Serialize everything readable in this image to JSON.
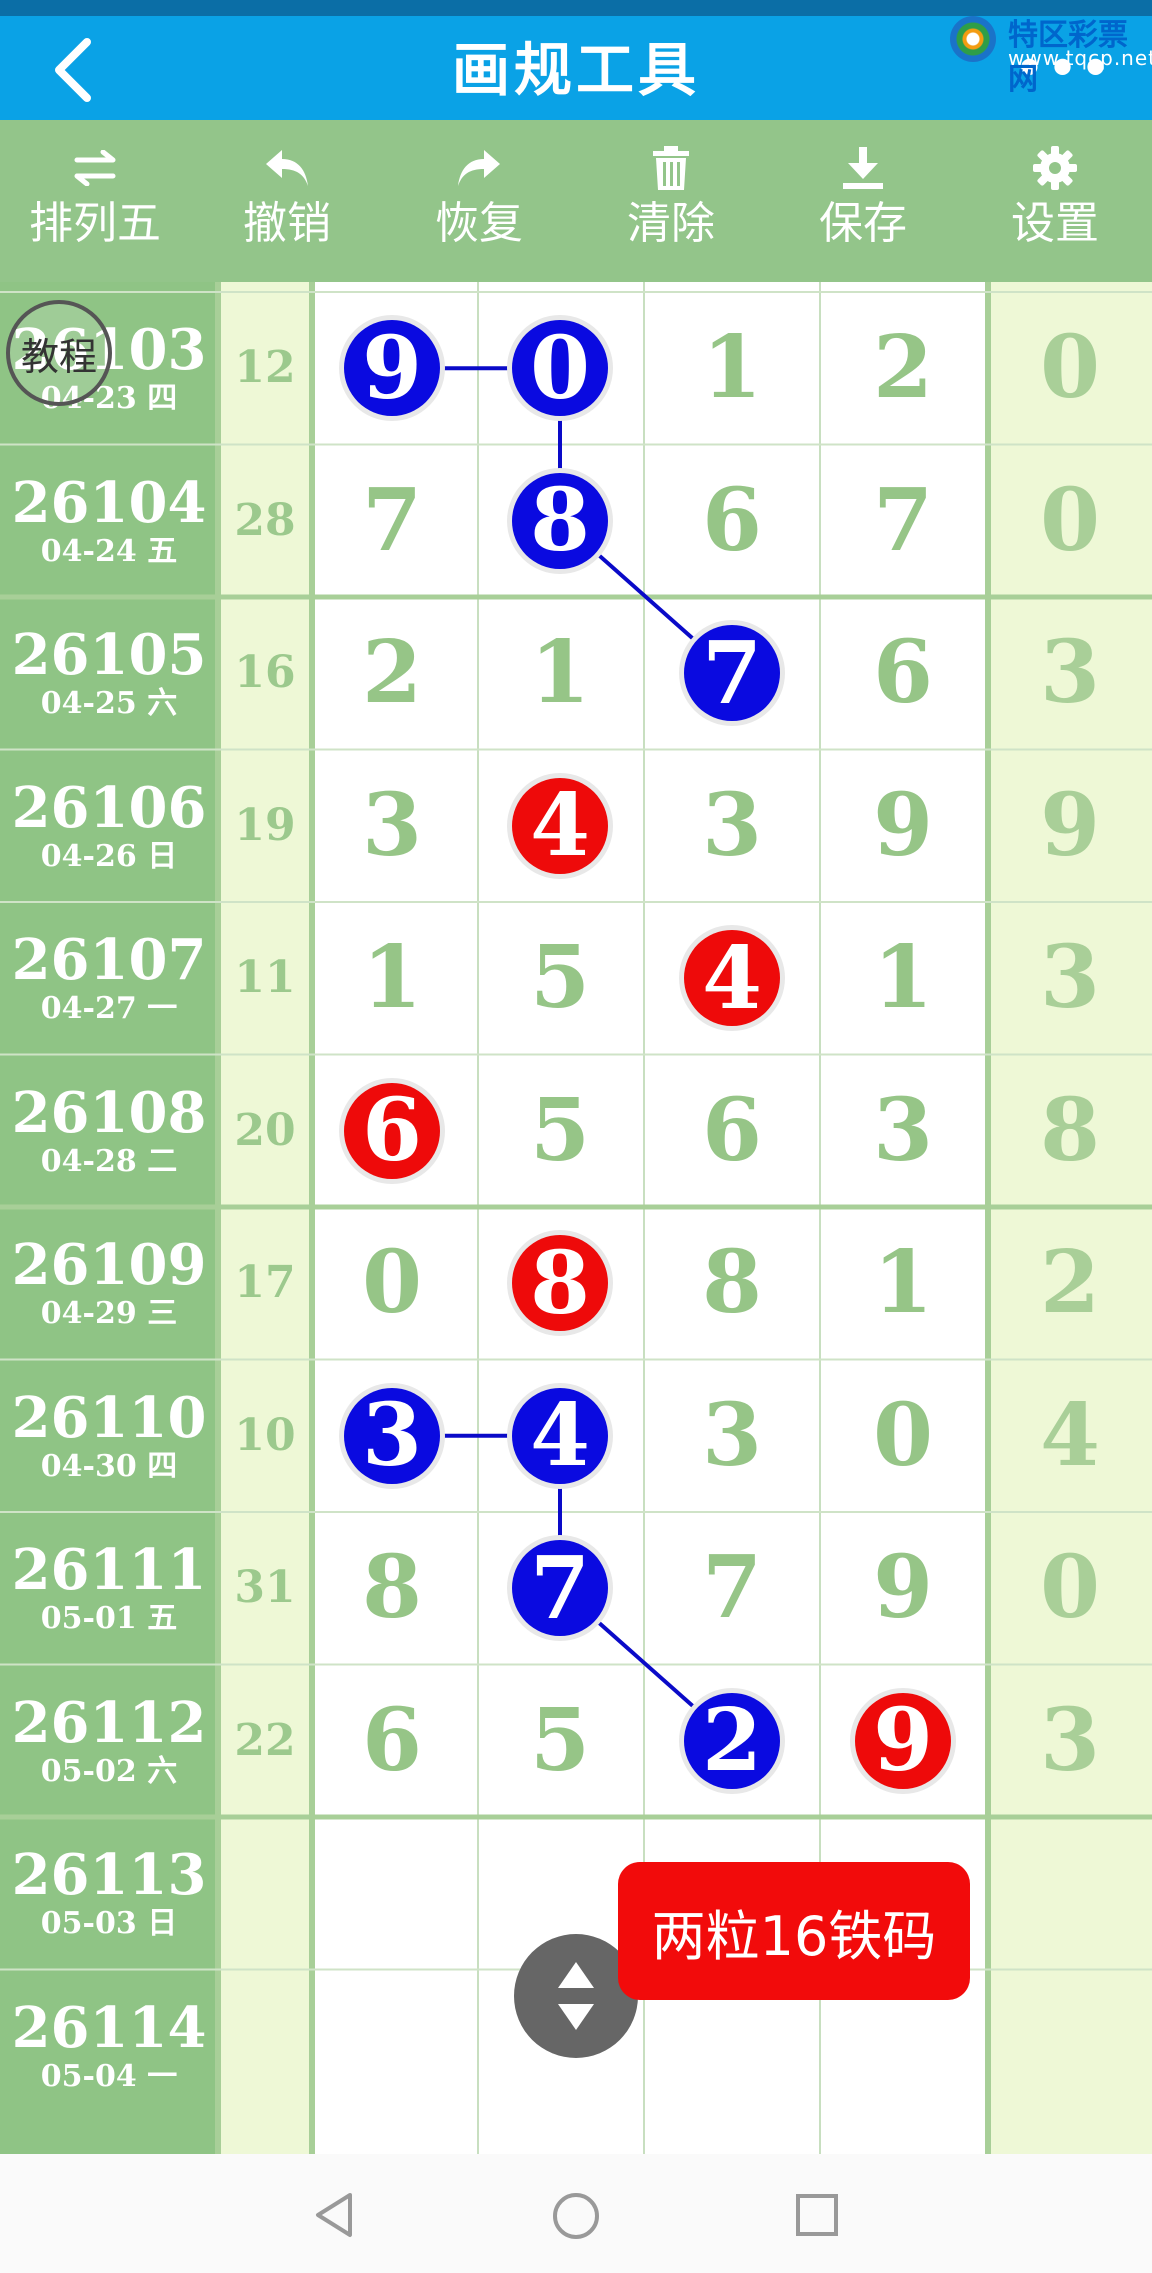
{
  "header": {
    "title": "画规工具",
    "more": "•••"
  },
  "logo": {
    "name": "特区彩票网",
    "url_text": "www.tqcp.net"
  },
  "toolbar": [
    {
      "label": "排列五",
      "icon": "swap-arrows-icon"
    },
    {
      "label": "撤销",
      "icon": "undo-icon"
    },
    {
      "label": "恢复",
      "icon": "redo-icon"
    },
    {
      "label": "清除",
      "icon": "trash-icon"
    },
    {
      "label": "保存",
      "icon": "download-icon"
    },
    {
      "label": "设置",
      "icon": "gear-icon"
    }
  ],
  "tutorial_badge": "教程",
  "rows": [
    {
      "period": "26103",
      "date": "04-23 四",
      "sum": "12",
      "digits": [
        "9",
        "0",
        "1",
        "2"
      ],
      "right": "0",
      "balls": [
        {
          "col": 0,
          "color": "blue"
        },
        {
          "col": 1,
          "color": "blue"
        }
      ]
    },
    {
      "period": "26104",
      "date": "04-24 五",
      "sum": "28",
      "digits": [
        "7",
        "8",
        "6",
        "7"
      ],
      "right": "0",
      "balls": [
        {
          "col": 1,
          "color": "blue"
        }
      ]
    },
    {
      "period": "26105",
      "date": "04-25 六",
      "sum": "16",
      "digits": [
        "2",
        "1",
        "7",
        "6"
      ],
      "right": "3",
      "balls": [
        {
          "col": 2,
          "color": "blue"
        }
      ]
    },
    {
      "period": "26106",
      "date": "04-26 日",
      "sum": "19",
      "digits": [
        "3",
        "4",
        "3",
        "9"
      ],
      "right": "9",
      "balls": [
        {
          "col": 1,
          "color": "red"
        }
      ]
    },
    {
      "period": "26107",
      "date": "04-27 一",
      "sum": "11",
      "digits": [
        "1",
        "5",
        "4",
        "1"
      ],
      "right": "3",
      "balls": [
        {
          "col": 2,
          "color": "red"
        }
      ]
    },
    {
      "period": "26108",
      "date": "04-28 二",
      "sum": "20",
      "digits": [
        "6",
        "5",
        "6",
        "3"
      ],
      "right": "8",
      "balls": [
        {
          "col": 0,
          "color": "red"
        }
      ]
    },
    {
      "period": "26109",
      "date": "04-29 三",
      "sum": "17",
      "digits": [
        "0",
        "8",
        "8",
        "1"
      ],
      "right": "2",
      "balls": [
        {
          "col": 1,
          "color": "red"
        }
      ]
    },
    {
      "period": "26110",
      "date": "04-30 四",
      "sum": "10",
      "digits": [
        "3",
        "4",
        "3",
        "0"
      ],
      "right": "4",
      "balls": [
        {
          "col": 0,
          "color": "blue"
        },
        {
          "col": 1,
          "color": "blue"
        }
      ]
    },
    {
      "period": "26111",
      "date": "05-01 五",
      "sum": "31",
      "digits": [
        "8",
        "7",
        "7",
        "9"
      ],
      "right": "0",
      "balls": [
        {
          "col": 1,
          "color": "blue"
        }
      ]
    },
    {
      "period": "26112",
      "date": "05-02 六",
      "sum": "22",
      "digits": [
        "6",
        "5",
        "2",
        "9"
      ],
      "right": "3",
      "balls": [
        {
          "col": 2,
          "color": "blue"
        },
        {
          "col": 3,
          "color": "red"
        }
      ]
    },
    {
      "period": "26113",
      "date": "05-03 日",
      "sum": "",
      "digits": [
        "",
        "",
        "",
        ""
      ],
      "right": "",
      "balls": []
    },
    {
      "period": "26114",
      "date": "05-04 一",
      "sum": "",
      "digits": [
        "",
        "",
        "",
        ""
      ],
      "right": "",
      "balls": []
    }
  ],
  "colors": {
    "blue_ball": "#0a0ae0",
    "red_ball": "#ee0a0a",
    "header": "#0aa2e6",
    "toolbar": "#93c58a"
  },
  "red_button": "两粒16铁码",
  "nav": {
    "back": "back-triangle-icon",
    "home": "home-circle-icon",
    "recent": "recent-square-icon"
  }
}
